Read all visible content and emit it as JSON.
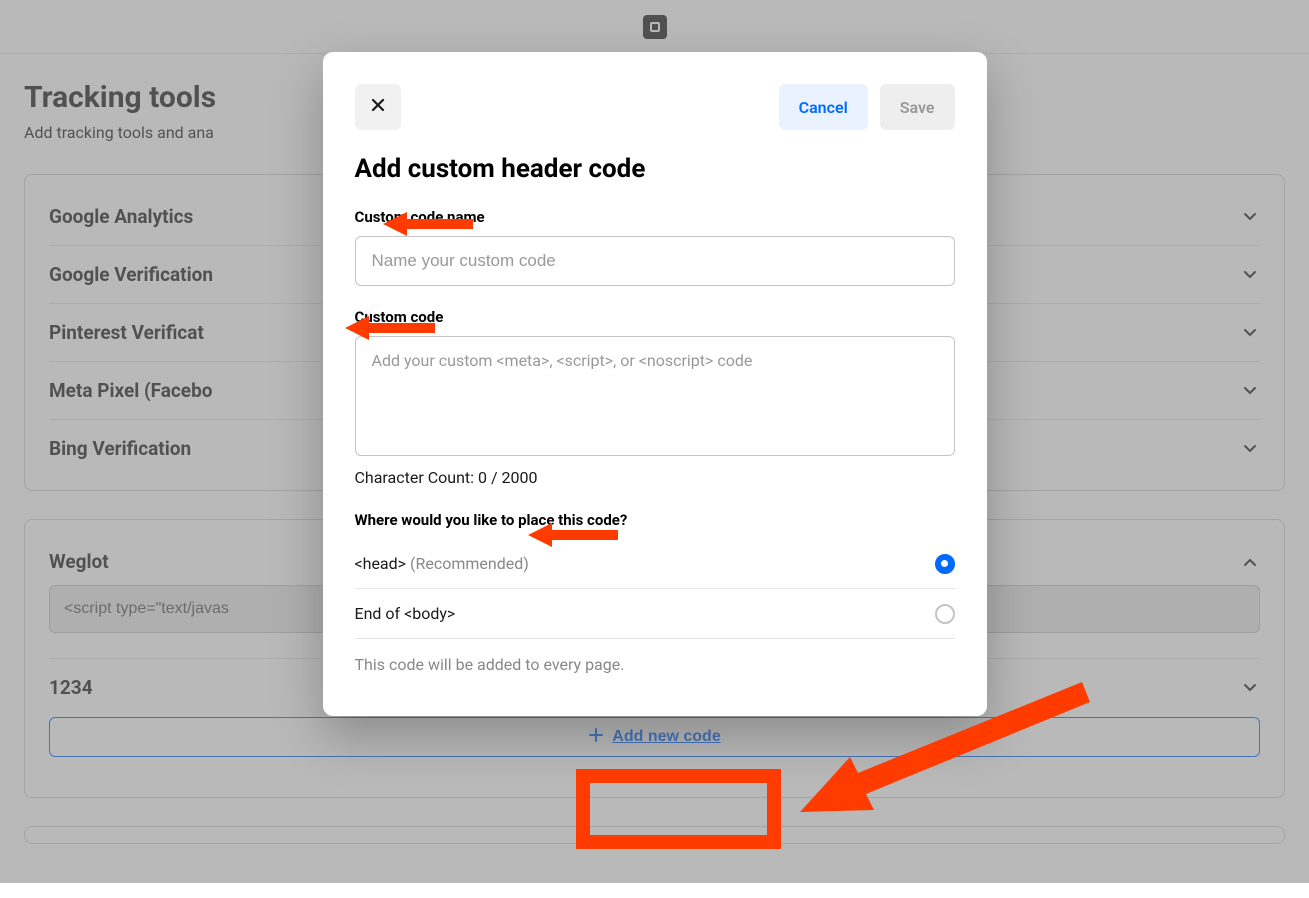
{
  "page": {
    "title": "Tracking tools",
    "subtitle": "Add tracking tools and ana"
  },
  "items_a": [
    {
      "label": "Google Analytics"
    },
    {
      "label": "Google Verification"
    },
    {
      "label": "Pinterest Verificat"
    },
    {
      "label": "Meta Pixel (Facebo"
    },
    {
      "label": "Bing Verification"
    }
  ],
  "weglot": {
    "label": "Weglot",
    "script_preview": "<script type=\"text/javas"
  },
  "item_1234": {
    "label": "1234"
  },
  "add_new_code": "Add new code",
  "modal": {
    "cancel": "Cancel",
    "save": "Save",
    "title": "Add custom header code",
    "name_label": "Custom code name",
    "name_placeholder": "Name your custom code",
    "code_label": "Custom code",
    "code_placeholder": "Add your custom <meta>, <script>, or <noscript> code",
    "char_count": "Character Count: 0 / 2000",
    "place_label": "Where would you like to place this code?",
    "option1_main": "<head> ",
    "option1_hint": "(Recommended)",
    "option2": "End of <body>",
    "helper": "This code will be added to every page."
  }
}
